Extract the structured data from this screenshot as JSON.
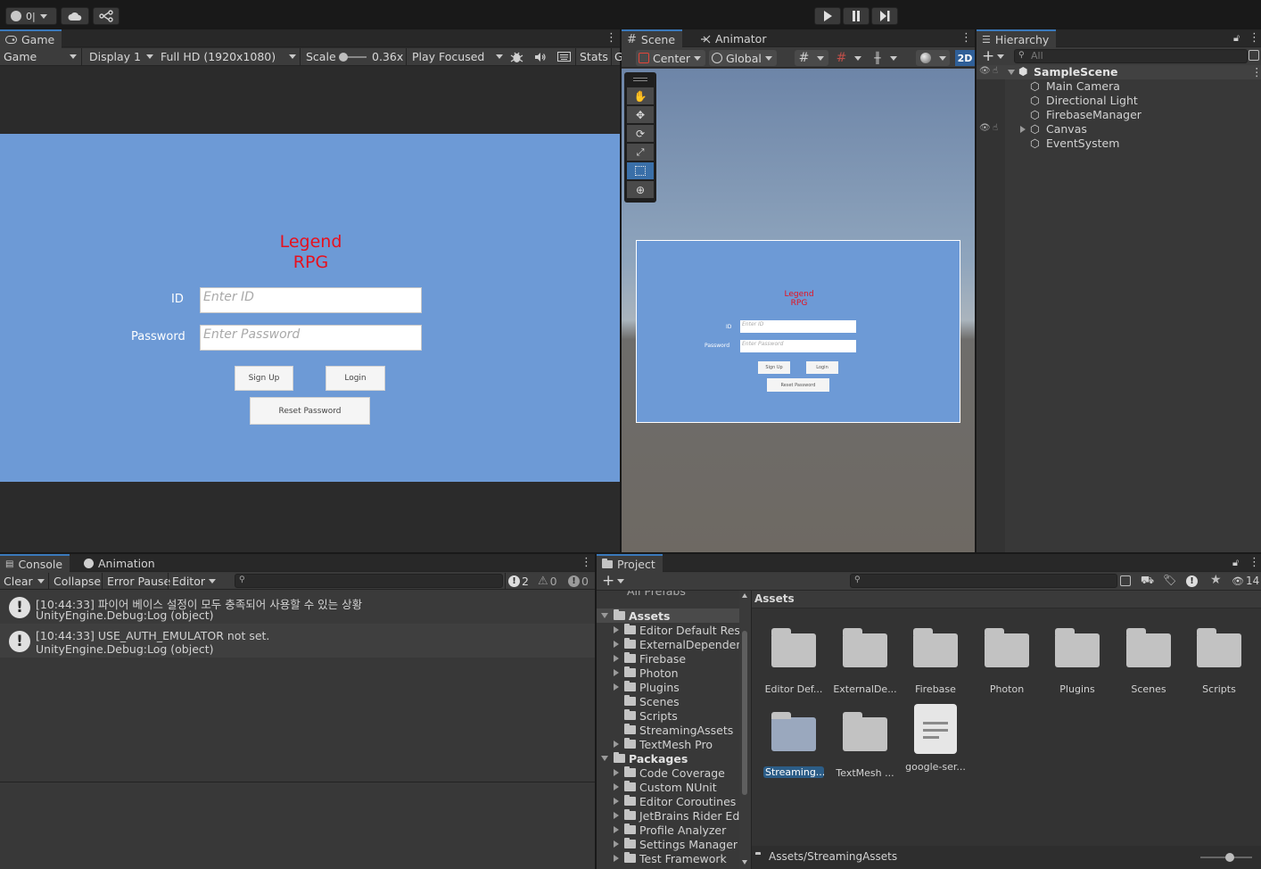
{
  "toolbar": {
    "account_label": "0|",
    "play_icon": "play-icon",
    "pause_icon": "pause-icon",
    "step_icon": "step-icon"
  },
  "game": {
    "tab_label": "Game",
    "mode_label": "Game",
    "display_label": "Display 1",
    "resolution_label": "Full HD (1920x1080)",
    "scale_label": "Scale",
    "scale_value": "0.36x",
    "play_focus_label": "Play Focused",
    "stats_label": "Stats",
    "g_label": "G",
    "title_line1": "Legend",
    "title_line2": "RPG",
    "id_label": "ID",
    "id_placeholder": "Enter ID",
    "password_label": "Password",
    "password_placeholder": "Enter Password",
    "signup_label": "Sign Up",
    "login_label": "Login",
    "reset_label": "Reset Password"
  },
  "scene": {
    "tab_label": "Scene",
    "animator_tab_label": "Animator",
    "pivot_label": "Center",
    "space_label": "Global",
    "mode_2d": "2D",
    "mini_title_line1": "Legend",
    "mini_title_line2": "RPG",
    "mini_id": "ID",
    "mini_password": "Password",
    "mini_id_placeholder": "Enter ID",
    "mini_pw_placeholder": "Enter Password",
    "mini_signup": "Sign Up",
    "mini_login": "Login",
    "mini_reset": "Reset Password"
  },
  "hierarchy": {
    "tab_label": "Hierarchy",
    "search_placeholder": "All",
    "scene_name": "SampleScene",
    "items": [
      "Main Camera",
      "Directional Light",
      "FirebaseManager",
      "Canvas",
      "EventSystem"
    ]
  },
  "console": {
    "tab_label": "Console",
    "animation_tab_label": "Animation",
    "clear_label": "Clear",
    "collapse_label": "Collapse",
    "error_pause_label": "Error Pause",
    "editor_label": "Editor",
    "info_count": "2",
    "warn_count": "0",
    "error_count": "0",
    "messages": [
      {
        "line1": "[10:44:33] 파이어 베이스 설정이 모두 충족되어 사용할 수 있는 상황",
        "line2": "UnityEngine.Debug:Log (object)"
      },
      {
        "line1": "[10:44:33] USE_AUTH_EMULATOR not set.",
        "line2": "UnityEngine.Debug:Log (object)"
      }
    ]
  },
  "project": {
    "tab_label": "Project",
    "hidden_count": "14",
    "tree_top_partial": "All Prefabs",
    "assets_root": "Assets",
    "asset_folders": [
      "Editor Default Resou",
      "ExternalDependenc",
      "Firebase",
      "Photon",
      "Plugins",
      "Scenes",
      "Scripts",
      "StreamingAssets",
      "TextMesh Pro"
    ],
    "packages_root": "Packages",
    "package_folders": [
      "Code Coverage",
      "Custom NUnit",
      "Editor Coroutines",
      "JetBrains Rider Edit",
      "Profile Analyzer",
      "Settings Manager",
      "Test Framework"
    ],
    "breadcrumb": "Assets",
    "grid_items": [
      "Editor Def...",
      "ExternalDe...",
      "Firebase",
      "Photon",
      "Plugins",
      "Scenes",
      "Scripts",
      "Streaming...",
      "TextMesh ...",
      "google-ser..."
    ],
    "status_path": "Assets/StreamingAssets"
  }
}
